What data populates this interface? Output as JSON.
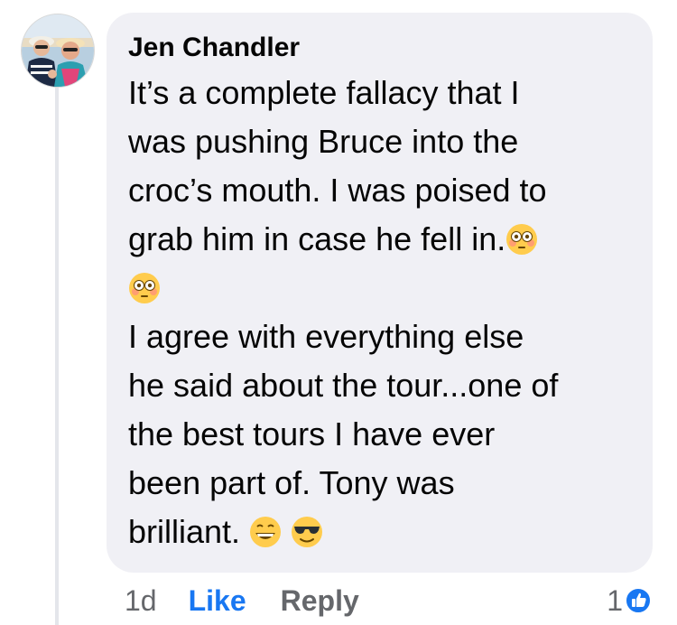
{
  "comment": {
    "author": "Jen Chandler",
    "lines": [
      "It’s a complete fallacy that I",
      "was pushing Bruce into the",
      "croc’s mouth. I was poised to",
      "grab him in case he fell in."
    ],
    "line_after_emoji": "",
    "lines_2": [
      "I agree with everything else",
      "he said about the tour...one of",
      "the best tours I have ever",
      "been part of. Tony was",
      "brilliant."
    ],
    "emojis": {
      "after_line_4": "flushed-face-emoji",
      "standalone": "flushed-face-emoji",
      "end_1": "grinning-face-emoji",
      "end_2": "sunglasses-face-emoji"
    }
  },
  "actions": {
    "time": "1d",
    "like_label": "Like",
    "reply_label": "Reply"
  },
  "reactions": {
    "count": "1",
    "icon": "like-badge-icon",
    "color": "#1877f2"
  },
  "colors": {
    "bubble": "#f0f0f5",
    "text": "#050505",
    "secondary": "#65676b",
    "link": "#1877f2"
  }
}
